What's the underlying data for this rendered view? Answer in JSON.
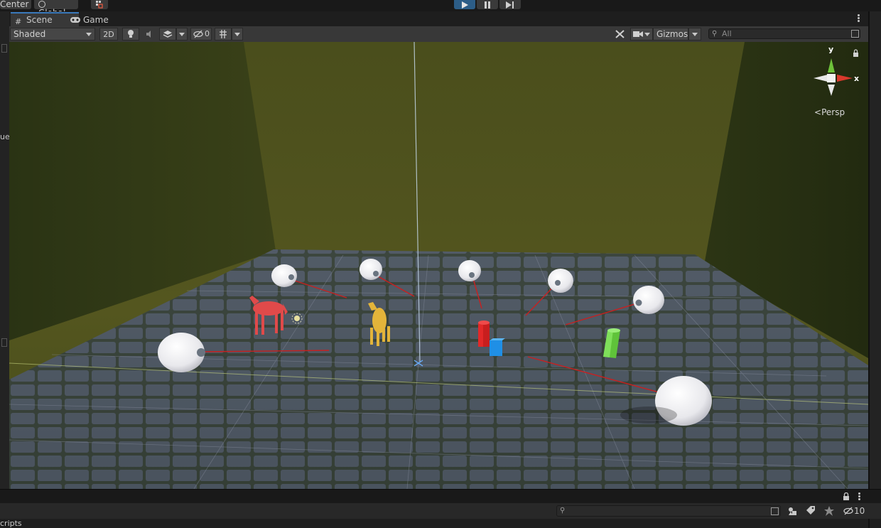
{
  "top_toolbar": {
    "pivot_label": "Center",
    "space_label": "Global",
    "playback": {
      "play": "play-icon",
      "pause": "pause-icon",
      "step": "step-icon",
      "play_active_color": "#2c5d87"
    }
  },
  "tabs": [
    {
      "label": "Scene",
      "icon": "grid-icon",
      "active": true
    },
    {
      "label": "Game",
      "icon": "gamepad-icon",
      "active": false
    }
  ],
  "scene_toolbar": {
    "draw_mode": "Shaded",
    "mode_2d": "2D",
    "hidden_count": "0",
    "gizmos_label": "Gizmos",
    "search_placeholder": "All"
  },
  "viewport": {
    "projection_label": "Persp",
    "axis_labels": {
      "y": "y",
      "x": "x"
    },
    "colors": {
      "y_axis": "#6ec23a",
      "x_axis": "#d9392c",
      "ray": "#c82020",
      "horse_red": "#e04a4a",
      "horse_yellow": "#e3b43a",
      "cyl_red": "#e22828",
      "cube_blue": "#1f8fe6",
      "cyl_green": "#6fd44a"
    }
  },
  "side_labels": {
    "left_partial": "ue"
  },
  "bottom_panel": {
    "partial_label": "cripts",
    "hidden_count": "10"
  }
}
